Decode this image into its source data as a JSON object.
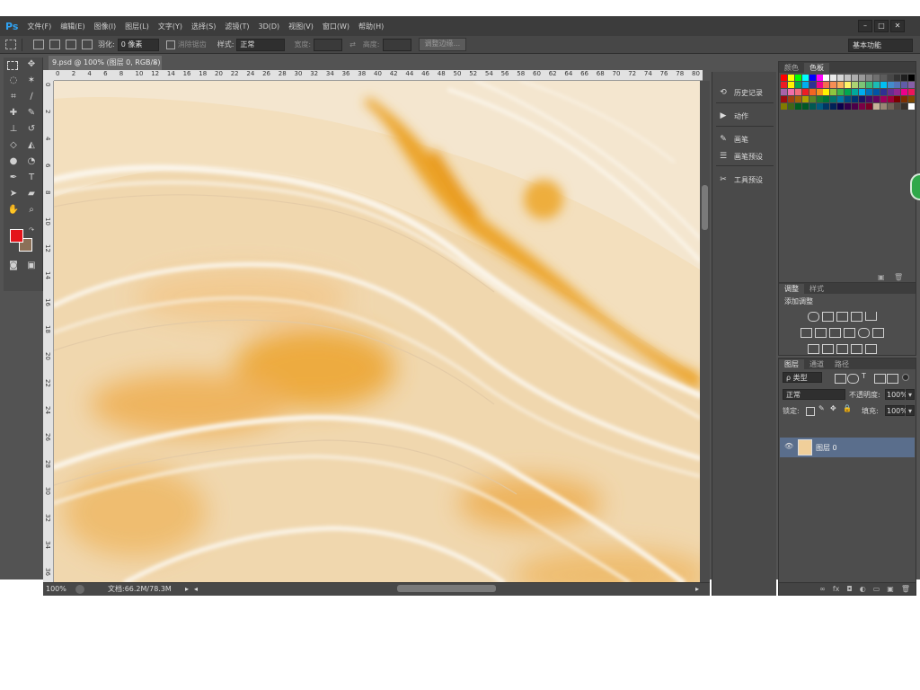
{
  "app": {
    "logo": "Ps",
    "menu": [
      "文件(F)",
      "编辑(E)",
      "图像(I)",
      "图层(L)",
      "文字(Y)",
      "选择(S)",
      "滤镜(T)",
      "3D(D)",
      "视图(V)",
      "窗口(W)",
      "帮助(H)"
    ],
    "window_controls": [
      "–",
      "□",
      "✕"
    ]
  },
  "options": {
    "feather_label": "羽化:",
    "feather_value": "0 像素",
    "antialias_label": "消除锯齿",
    "style_label": "样式:",
    "style_value": "正常",
    "width_label": "宽度:",
    "height_label": "高度:",
    "refine_button": "调整边缘...",
    "workspace": "基本功能"
  },
  "document": {
    "tab_title": "9.psd @ 100% (图层 0, RGB/8)",
    "tab_close": "×",
    "ruler_h": [
      "0",
      "2",
      "4",
      "6",
      "8",
      "10",
      "12",
      "14",
      "16",
      "18",
      "20",
      "22",
      "24",
      "26",
      "28",
      "30",
      "32",
      "34",
      "36",
      "38",
      "40",
      "42",
      "44",
      "46",
      "48",
      "50",
      "52",
      "54",
      "56",
      "58",
      "60",
      "62",
      "64",
      "66",
      "68",
      "70",
      "72",
      "74",
      "76",
      "78",
      "80"
    ],
    "ruler_v": [
      "0",
      "2",
      "4",
      "6",
      "8",
      "10",
      "12",
      "14",
      "16",
      "18",
      "20",
      "22",
      "24",
      "26",
      "28",
      "30",
      "32",
      "34",
      "36"
    ],
    "zoom": "100%",
    "doc_info": "文档:66.2M/78.3M"
  },
  "dock": {
    "items": [
      {
        "label": "历史记录",
        "icon": "history-icon"
      },
      {
        "label": "动作",
        "icon": "play-icon"
      },
      {
        "label": "画笔",
        "icon": "brush-icon"
      },
      {
        "label": "画笔预设",
        "icon": "brush-preset-icon"
      },
      {
        "label": "工具预设",
        "icon": "tool-preset-icon"
      }
    ]
  },
  "color_panel": {
    "tabs": [
      "颜色",
      "色板"
    ],
    "active_tab": 1
  },
  "adjustments_panel": {
    "tabs": [
      "调整",
      "样式"
    ],
    "title": "添加调整"
  },
  "layers_panel": {
    "tabs": [
      "图层",
      "通道",
      "路径"
    ],
    "filter_label": "ρ 类型",
    "blend_mode": "正常",
    "opacity_label": "不透明度:",
    "opacity_value": "100%",
    "lock_label": "锁定:",
    "fill_label": "填充:",
    "fill_value": "100%",
    "layers": [
      {
        "name": "图层 0",
        "visible": true
      }
    ],
    "footer_icons": [
      "∞",
      "fx",
      "◘",
      "◐",
      "▭",
      "▣",
      "🗑"
    ]
  },
  "colors": {
    "foreground": "#e4141b",
    "background": "#8a7058",
    "accent": "#2fa3f4"
  }
}
